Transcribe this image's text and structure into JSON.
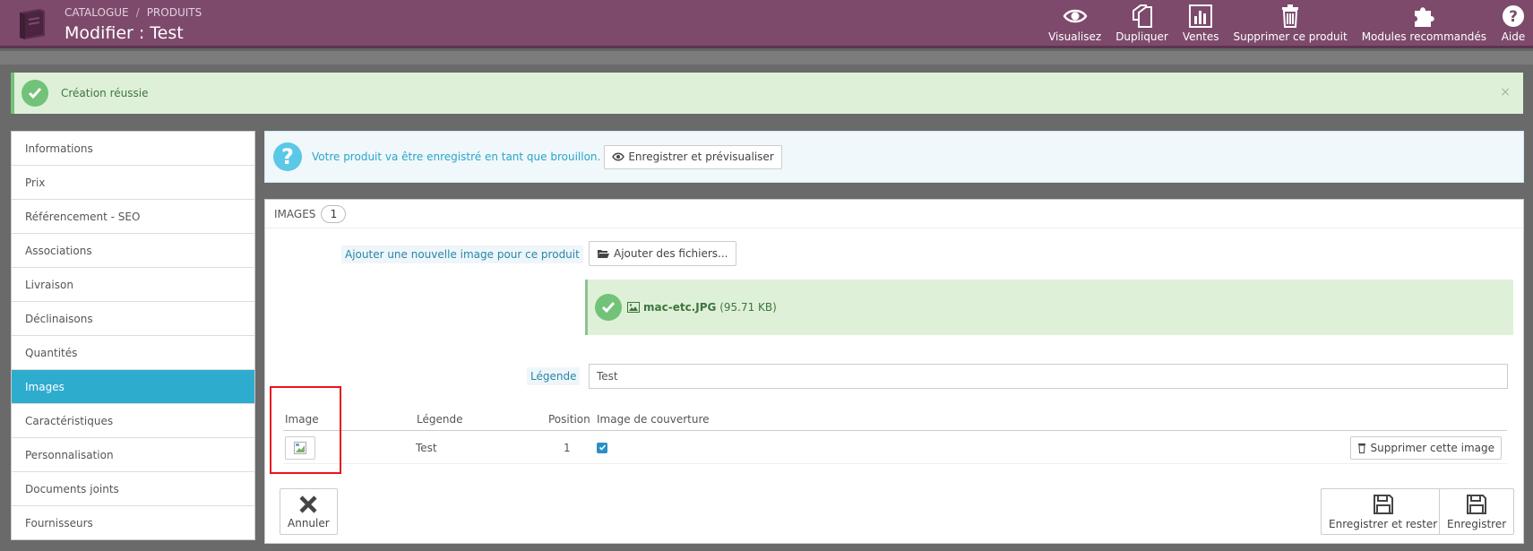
{
  "header": {
    "breadcrumb": [
      "CATALOGUE",
      "PRODUITS"
    ],
    "breadcrumb_sep": "/",
    "title": "Modifier : Test",
    "toolbar": [
      {
        "label": "Visualisez",
        "icon": "eye-icon"
      },
      {
        "label": "Dupliquer",
        "icon": "copy-icon"
      },
      {
        "label": "Ventes",
        "icon": "bar-chart-icon"
      },
      {
        "label": "Supprimer ce produit",
        "icon": "trash-icon"
      },
      {
        "label": "Modules recommandés",
        "icon": "puzzle-icon"
      },
      {
        "label": "Aide",
        "icon": "help-icon"
      }
    ]
  },
  "alert": {
    "text": "Création réussie",
    "close": "×"
  },
  "sidebar": {
    "items": [
      {
        "label": "Informations"
      },
      {
        "label": "Prix"
      },
      {
        "label": "Référencement - SEO"
      },
      {
        "label": "Associations"
      },
      {
        "label": "Livraison"
      },
      {
        "label": "Déclinaisons"
      },
      {
        "label": "Quantités"
      },
      {
        "label": "Images",
        "active": true
      },
      {
        "label": "Caractéristiques"
      },
      {
        "label": "Personnalisation"
      },
      {
        "label": "Documents joints"
      },
      {
        "label": "Fournisseurs"
      }
    ]
  },
  "info": {
    "text": "Votre produit va être enregistré en tant que brouillon.",
    "preview_button": "Enregistrer et prévisualiser"
  },
  "panel": {
    "title": "IMAGES",
    "count": "1",
    "add_label": "Ajouter une nouvelle image pour ce produit",
    "add_button": "Ajouter des fichiers...",
    "upload": {
      "filename": "mac-etc.JPG",
      "size": "(95.71 KB)"
    },
    "legend_label": "Légende",
    "legend_value": "Test",
    "table": {
      "headers": [
        "Image",
        "Légende",
        "Position",
        "Image de couverture"
      ],
      "rows": [
        {
          "legend": "Test",
          "position": "1",
          "cover": true,
          "delete_label": "Supprimer cette image"
        }
      ]
    },
    "footer": {
      "cancel": "Annuler",
      "save_stay": "Enregistrer et rester",
      "save": "Enregistrer"
    }
  },
  "colors": {
    "header_bg": "#7d4a6c",
    "active_tab": "#2eacce",
    "success_bg": "#dff0d8",
    "success_icon": "#72c279",
    "highlight": "#e8131b"
  }
}
